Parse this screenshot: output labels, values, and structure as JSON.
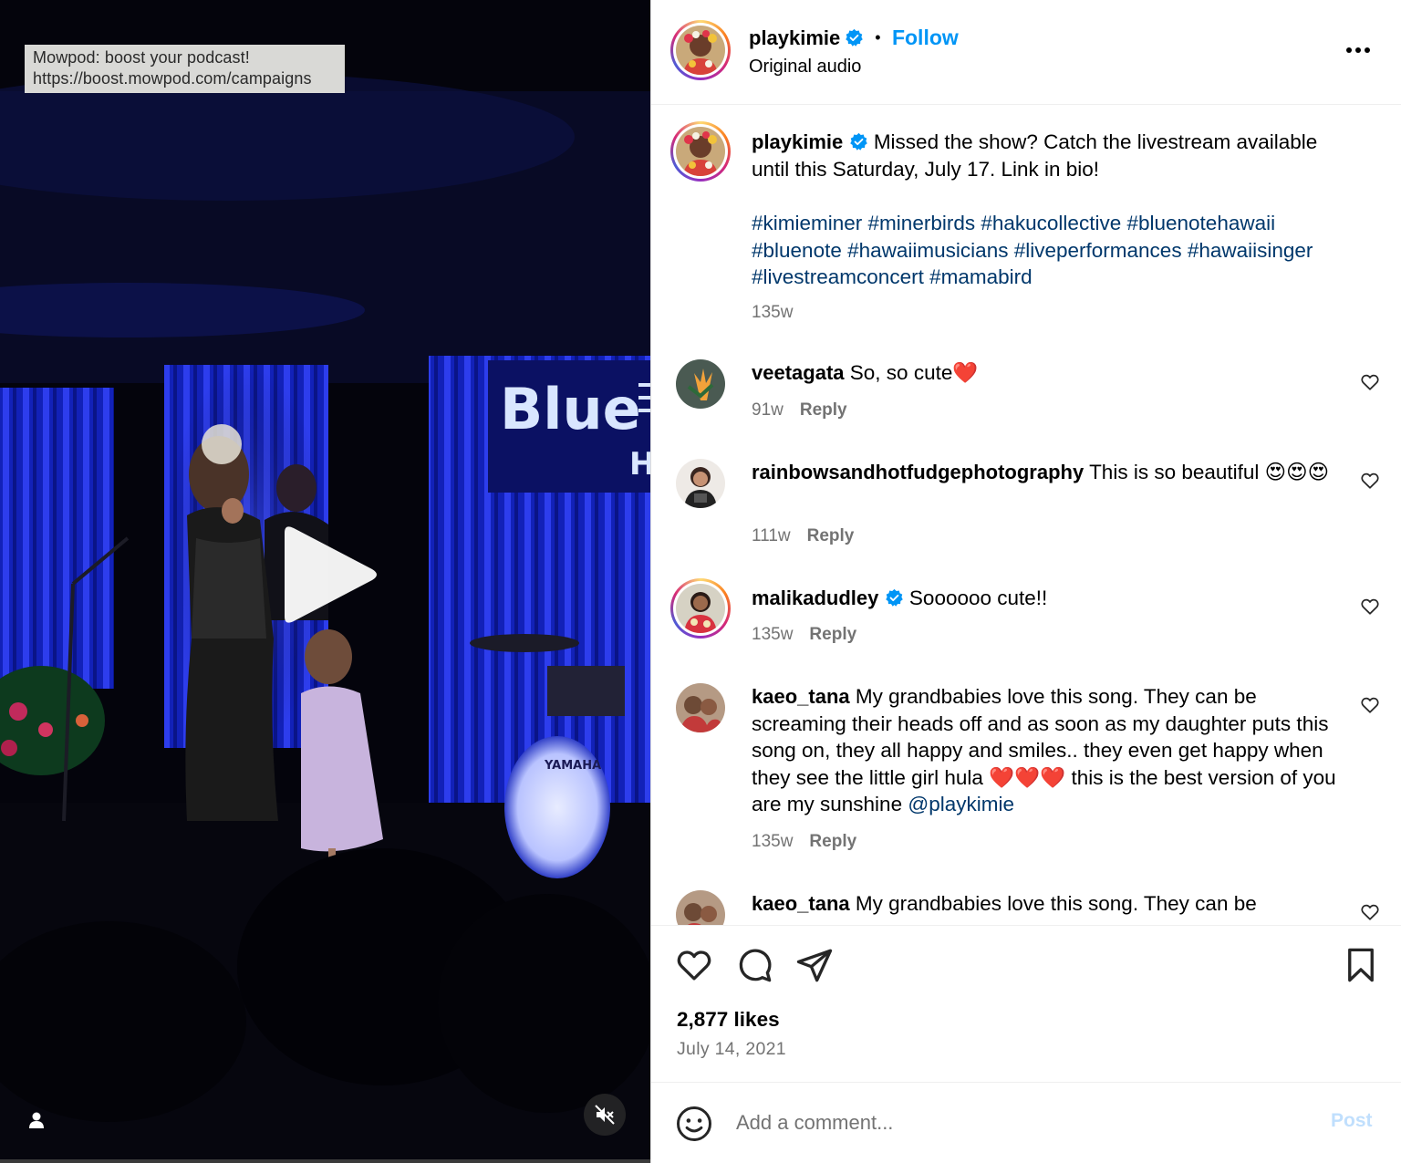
{
  "video": {
    "tooltip_line1": "Mowpod: boost your podcast!",
    "tooltip_line2": "https://boost.mowpod.com/campaigns",
    "sign_text": "Blue",
    "sign_subtext": "H",
    "drum_brand": "YAMAHA",
    "play_icon": "play-icon",
    "mute_icon": "speaker-muted-icon",
    "user_icon": "user-tag-icon"
  },
  "header": {
    "username": "playkimie",
    "verified": true,
    "separator": "•",
    "follow_label": "Follow",
    "audio_label": "Original audio",
    "more_icon": "more-horizontal-icon"
  },
  "caption": {
    "username": "playkimie",
    "text": "Missed the show? Catch the livestream available until this Saturday, July 17. Link in bio!",
    "hashtags": [
      "#kimieminer",
      "#minerbirds",
      "#hakucollective",
      "#bluenotehawaii",
      "#bluenote",
      "#hawaiimusicians",
      "#liveperformances",
      "#hawaiisinger",
      "#livestreamconcert",
      "#mamabird"
    ],
    "age": "135w"
  },
  "comments": [
    {
      "username": "veetagata",
      "text": "So, so cute",
      "emoji": "❤️",
      "age": "91w",
      "reply": "Reply"
    },
    {
      "username": "rainbowsandhotfudgephotography",
      "text": "This is so beautiful",
      "emoji": "😍😍😍",
      "age": "111w",
      "reply": "Reply"
    },
    {
      "username": "malikadudley",
      "verified": true,
      "text": "Soooooo cute!!",
      "age": "135w",
      "reply": "Reply"
    },
    {
      "username": "kaeo_tana",
      "text_before": "My grandbabies love this song. They can be screaming their heads off and as soon as my daughter puts this song on, they all happy and smiles.. they even get happy when they see the little girl hula",
      "hearts": "❤️❤️❤️",
      "text_after": "this is the best version of you are my sunshine",
      "mention": "@playkimie",
      "age": "135w",
      "reply": "Reply"
    },
    {
      "username": "kaeo_tana",
      "text": "My grandbabies love this song. They can be"
    }
  ],
  "actions": {
    "like_icon": "heart-icon",
    "comment_icon": "comment-icon",
    "share_icon": "share-icon",
    "save_icon": "bookmark-icon",
    "likes": "2,877 likes",
    "date": "July 14, 2021"
  },
  "composer": {
    "emoji_icon": "emoji-smiley-icon",
    "placeholder": "Add a comment...",
    "post_label": "Post"
  },
  "colors": {
    "accent": "#0095f6",
    "hashtag": "#00376b",
    "muted": "#737373",
    "stage_blue": "#1a2bd6"
  }
}
